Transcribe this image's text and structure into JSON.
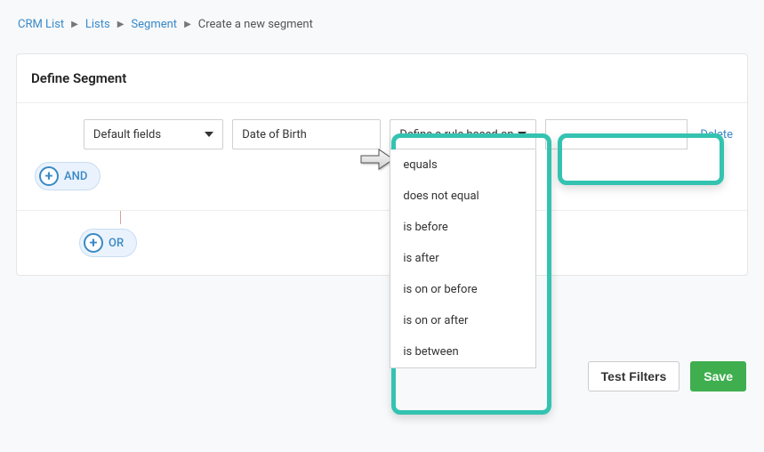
{
  "breadcrumb": {
    "items": [
      "CRM List",
      "Lists",
      "Segment"
    ],
    "current": "Create a new segment"
  },
  "panel": {
    "title": "Define Segment"
  },
  "rule": {
    "field_type": "Default fields",
    "field": "Date of Birth",
    "rule_placeholder": "Define a rule based on",
    "value": "",
    "delete_label": "Delete"
  },
  "rule_menu": {
    "options": [
      "equals",
      "does not equal",
      "is before",
      "is after",
      "is on or before",
      "is on or after",
      "is between"
    ]
  },
  "pills": {
    "and": "AND",
    "or": "OR"
  },
  "footer": {
    "test": "Test Filters",
    "save": "Save"
  }
}
